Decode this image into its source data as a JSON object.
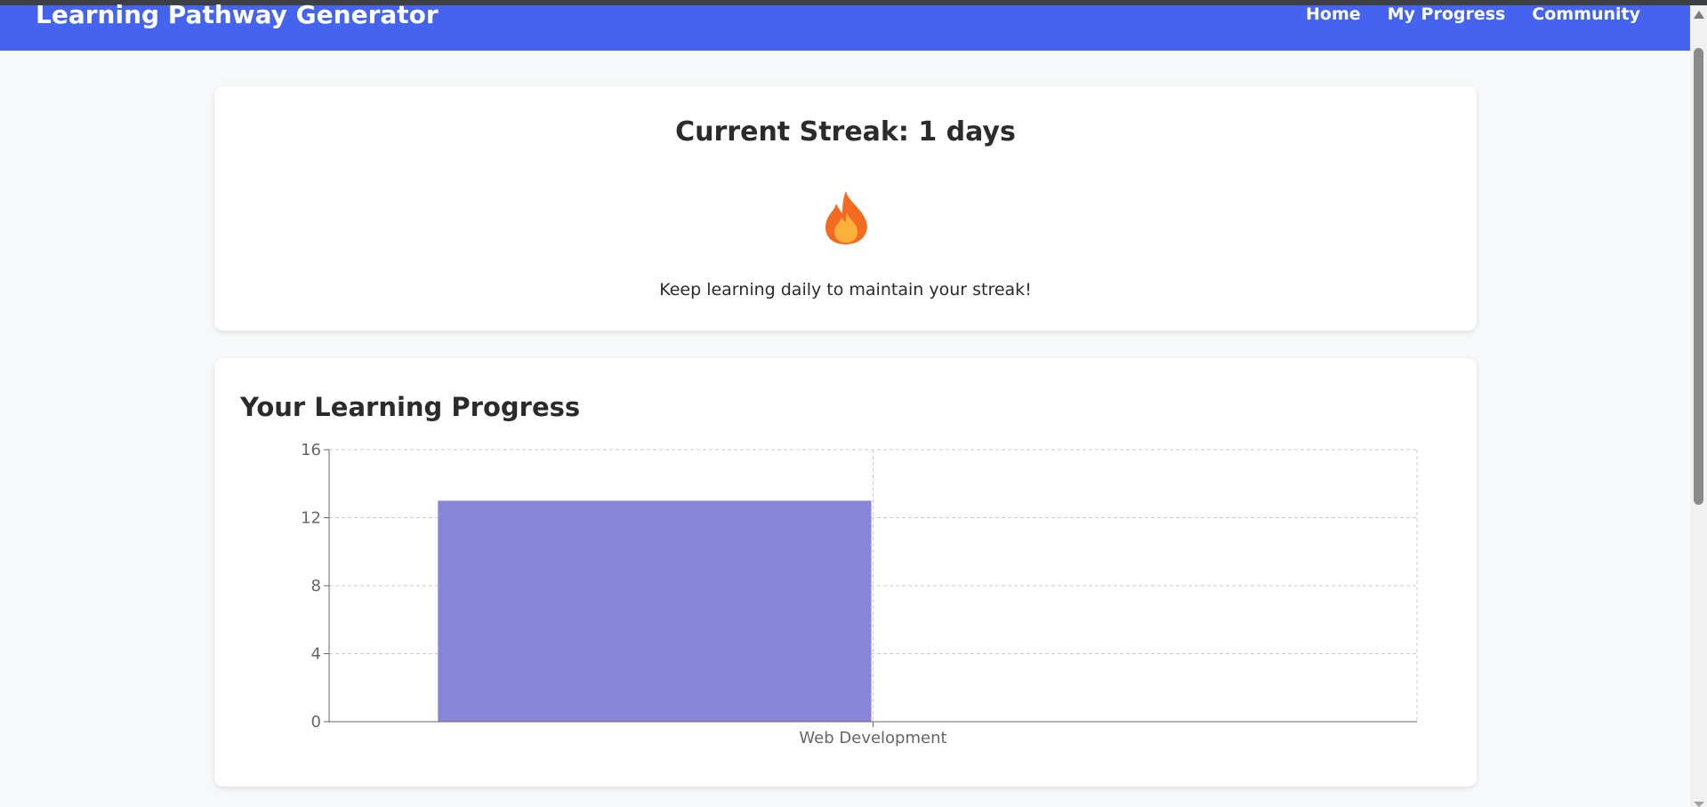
{
  "header": {
    "brand": "Learning Pathway Generator",
    "nav": [
      "Home",
      "My Progress",
      "Community"
    ],
    "color": "#4463ee"
  },
  "streak": {
    "title": "Current Streak: 1 days",
    "icon": "fire-icon",
    "message": "Keep learning daily to maintain your streak!"
  },
  "progress": {
    "title": "Your Learning Progress"
  },
  "chart_data": {
    "type": "bar",
    "categories": [
      "Web Development"
    ],
    "values": [
      13
    ],
    "ylim": [
      0,
      16
    ],
    "yticks": [
      0,
      4,
      8,
      12,
      16
    ],
    "grid": true,
    "bar_color": "#8884d8",
    "title": "",
    "xlabel": "",
    "ylabel": ""
  }
}
